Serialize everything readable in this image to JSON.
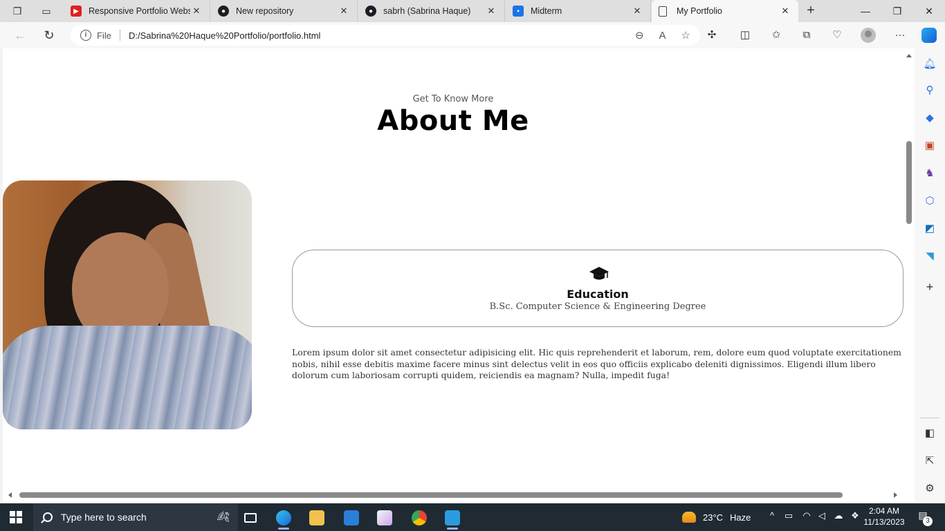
{
  "browser": {
    "tabs": [
      {
        "title": "Responsive Portfolio Websit",
        "favicon": "youtube-icon",
        "active": false
      },
      {
        "title": "New repository",
        "favicon": "github-icon",
        "active": false
      },
      {
        "title": "sabrh (Sabrina Haque)",
        "favicon": "github-icon",
        "active": false
      },
      {
        "title": "Midterm",
        "favicon": "classroom-icon",
        "active": false
      },
      {
        "title": "My Portfolio",
        "favicon": "file-icon",
        "active": true
      }
    ],
    "address": {
      "scheme_label": "File",
      "url": "D:/Sabrina%20Haque%20Portfolio/portfolio.html"
    }
  },
  "page": {
    "subtitle": "Get To Know More",
    "title": "About Me",
    "education": {
      "title": "Education",
      "description": "B.Sc. Computer Science & Engineering Degree"
    },
    "paragraph": "Lorem ipsum dolor sit amet consectetur adipisicing elit. Hic quis reprehenderit et laborum, rem, dolore eum quod voluptate exercitationem nobis, nihil esse debitis maxime facere minus sint delectus velit in eos quo officiis explicabo deleniti dignissimos. Eligendi illum libero dolorum cum laboriosam corrupti quidem, reiciendis ea magnam? Nulla, impedit fuga!"
  },
  "taskbar": {
    "search_placeholder": "Type here to search",
    "weather": {
      "temperature": "23°C",
      "condition": "Haze"
    },
    "clock": {
      "time": "2:04 AM",
      "date": "11/13/2023"
    },
    "notification_count": "3"
  },
  "colors": {
    "taskbar": "#1f2a33",
    "accent": "#0f6cbd"
  }
}
